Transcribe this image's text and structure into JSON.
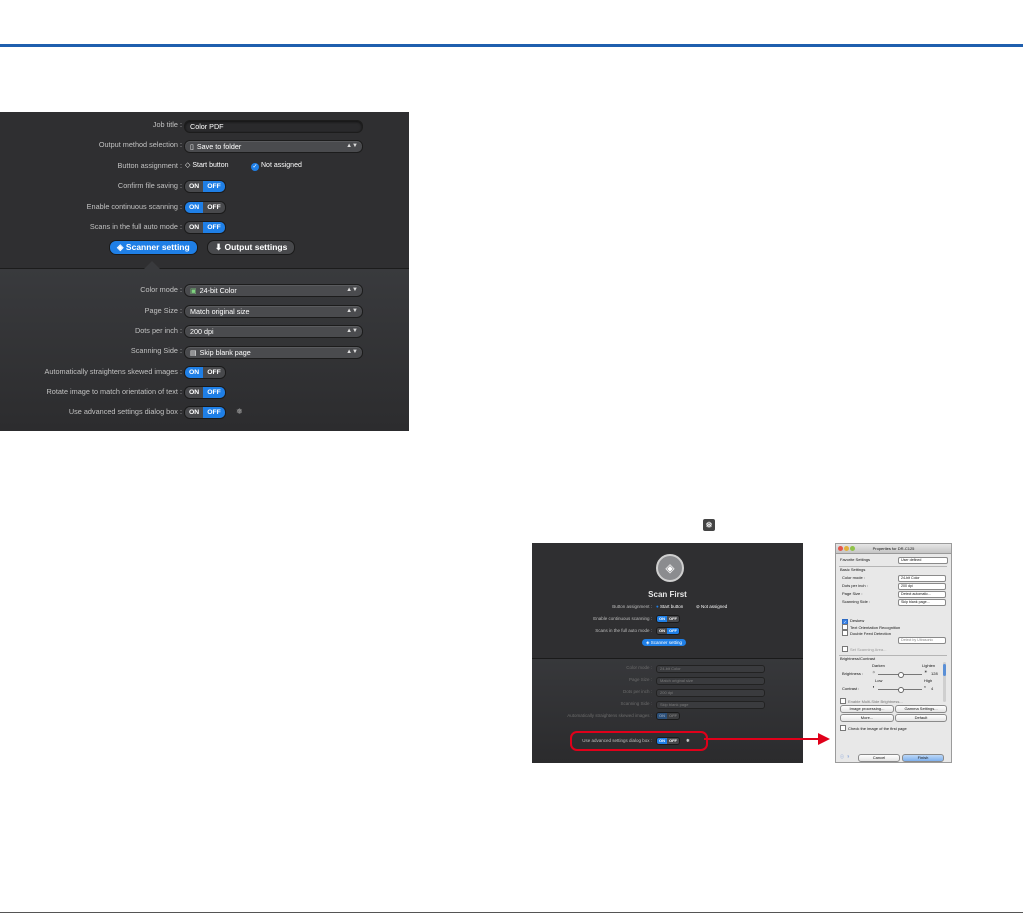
{
  "panel_a": {
    "job_title": {
      "label": "Job title :",
      "value": "Color PDF"
    },
    "output_method": {
      "label": "Output method selection :",
      "value": "Save to folder"
    },
    "button_assignment": {
      "label": "Button assignment :",
      "start": "Start button",
      "not_assigned": "Not assigned"
    },
    "confirm_file_saving": {
      "label": "Confirm file saving :",
      "on": "ON",
      "off": "OFF",
      "state": "OFF"
    },
    "continuous_scanning": {
      "label": "Enable continuous scanning :",
      "on": "ON",
      "off": "OFF",
      "state": "ON"
    },
    "full_auto_mode": {
      "label": "Scans in the full auto mode :",
      "on": "ON",
      "off": "OFF",
      "state": "OFF"
    },
    "tabs": {
      "scanner_setting": "Scanner setting",
      "output_settings": "Output settings"
    },
    "color_mode": {
      "label": "Color mode :",
      "value": "24-bit Color"
    },
    "page_size": {
      "label": "Page Size :",
      "value": "Match original size"
    },
    "dots_per_inch": {
      "label": "Dots per inch :",
      "value": "200 dpi"
    },
    "scanning_side": {
      "label": "Scanning Side :",
      "value": "Skip blank page"
    },
    "straighten": {
      "label": "Automatically straightens skewed images :",
      "on": "ON",
      "off": "OFF",
      "state": "ON"
    },
    "rotate": {
      "label": "Rotate image to match orientation of text :",
      "on": "ON",
      "off": "OFF",
      "state": "OFF"
    },
    "advanced": {
      "label": "Use advanced settings dialog box :",
      "on": "ON",
      "off": "OFF",
      "state": "OFF"
    }
  },
  "panel_b": {
    "title": "Scan First",
    "button_assignment": {
      "label": "Button assignment :",
      "start": "Start button",
      "not_assigned": "Not assigned"
    },
    "continuous": {
      "label": "Enable continuous scanning :",
      "on": "ON",
      "off": "OFF"
    },
    "full_auto": {
      "label": "Scans in the full auto mode :",
      "on": "ON",
      "off": "OFF"
    },
    "scanner_setting": "Scanner setting",
    "color_mode": {
      "label": "Color mode :",
      "value": "24-bit Color"
    },
    "page_size": {
      "label": "Page Size :",
      "value": "Match original size"
    },
    "dpi": {
      "label": "Dots per inch :",
      "value": "200 dpi"
    },
    "side": {
      "label": "Scanning Side :",
      "value": "Skip blank page"
    },
    "straighten": {
      "label": "Automatically straightens skewed images :",
      "on": "ON",
      "off": "OFF"
    },
    "advanced": {
      "label": "Use advanced settings dialog box :",
      "on": "ON",
      "off": "OFF"
    }
  },
  "dialog": {
    "title": "Properties for DR-C125",
    "favorite_settings": {
      "label": "Favorite Settings",
      "value": "User defined"
    },
    "basic_settings": "Basic Settings",
    "color_mode": {
      "label": "Color mode :",
      "value": "24-bit Color"
    },
    "dpi": {
      "label": "Dots per inch :",
      "value": "200 dpi"
    },
    "page_size": {
      "label": "Page Size :",
      "value": "Detect automatic..."
    },
    "side": {
      "label": "Scanning Side :",
      "value": "Skip blank page..."
    },
    "deskew": "Deskew",
    "text_orientation": "Text Orientation Recognition",
    "double_feed": "Double Feed Detection",
    "detect_by": "Detect by Ultrasonic",
    "set_scanning_area": "Set Scanning Area...",
    "brightness_contrast": "Brightness/Contrast",
    "darken": "Darken",
    "lighten": "Lighten",
    "brightness": {
      "label": "Brightness :",
      "value": "128"
    },
    "low": "Low",
    "high": "High",
    "contrast": {
      "label": "Contrast :",
      "value": "4"
    },
    "enable_multi": "Enable Multi-Side Brightness...",
    "image_processing": "Image processing...",
    "gamma": "Gamma Settings...",
    "more": "More...",
    "default": "Default",
    "check_first": "Check the image of the first page",
    "cancel": "Cancel",
    "finish": "Finish"
  }
}
